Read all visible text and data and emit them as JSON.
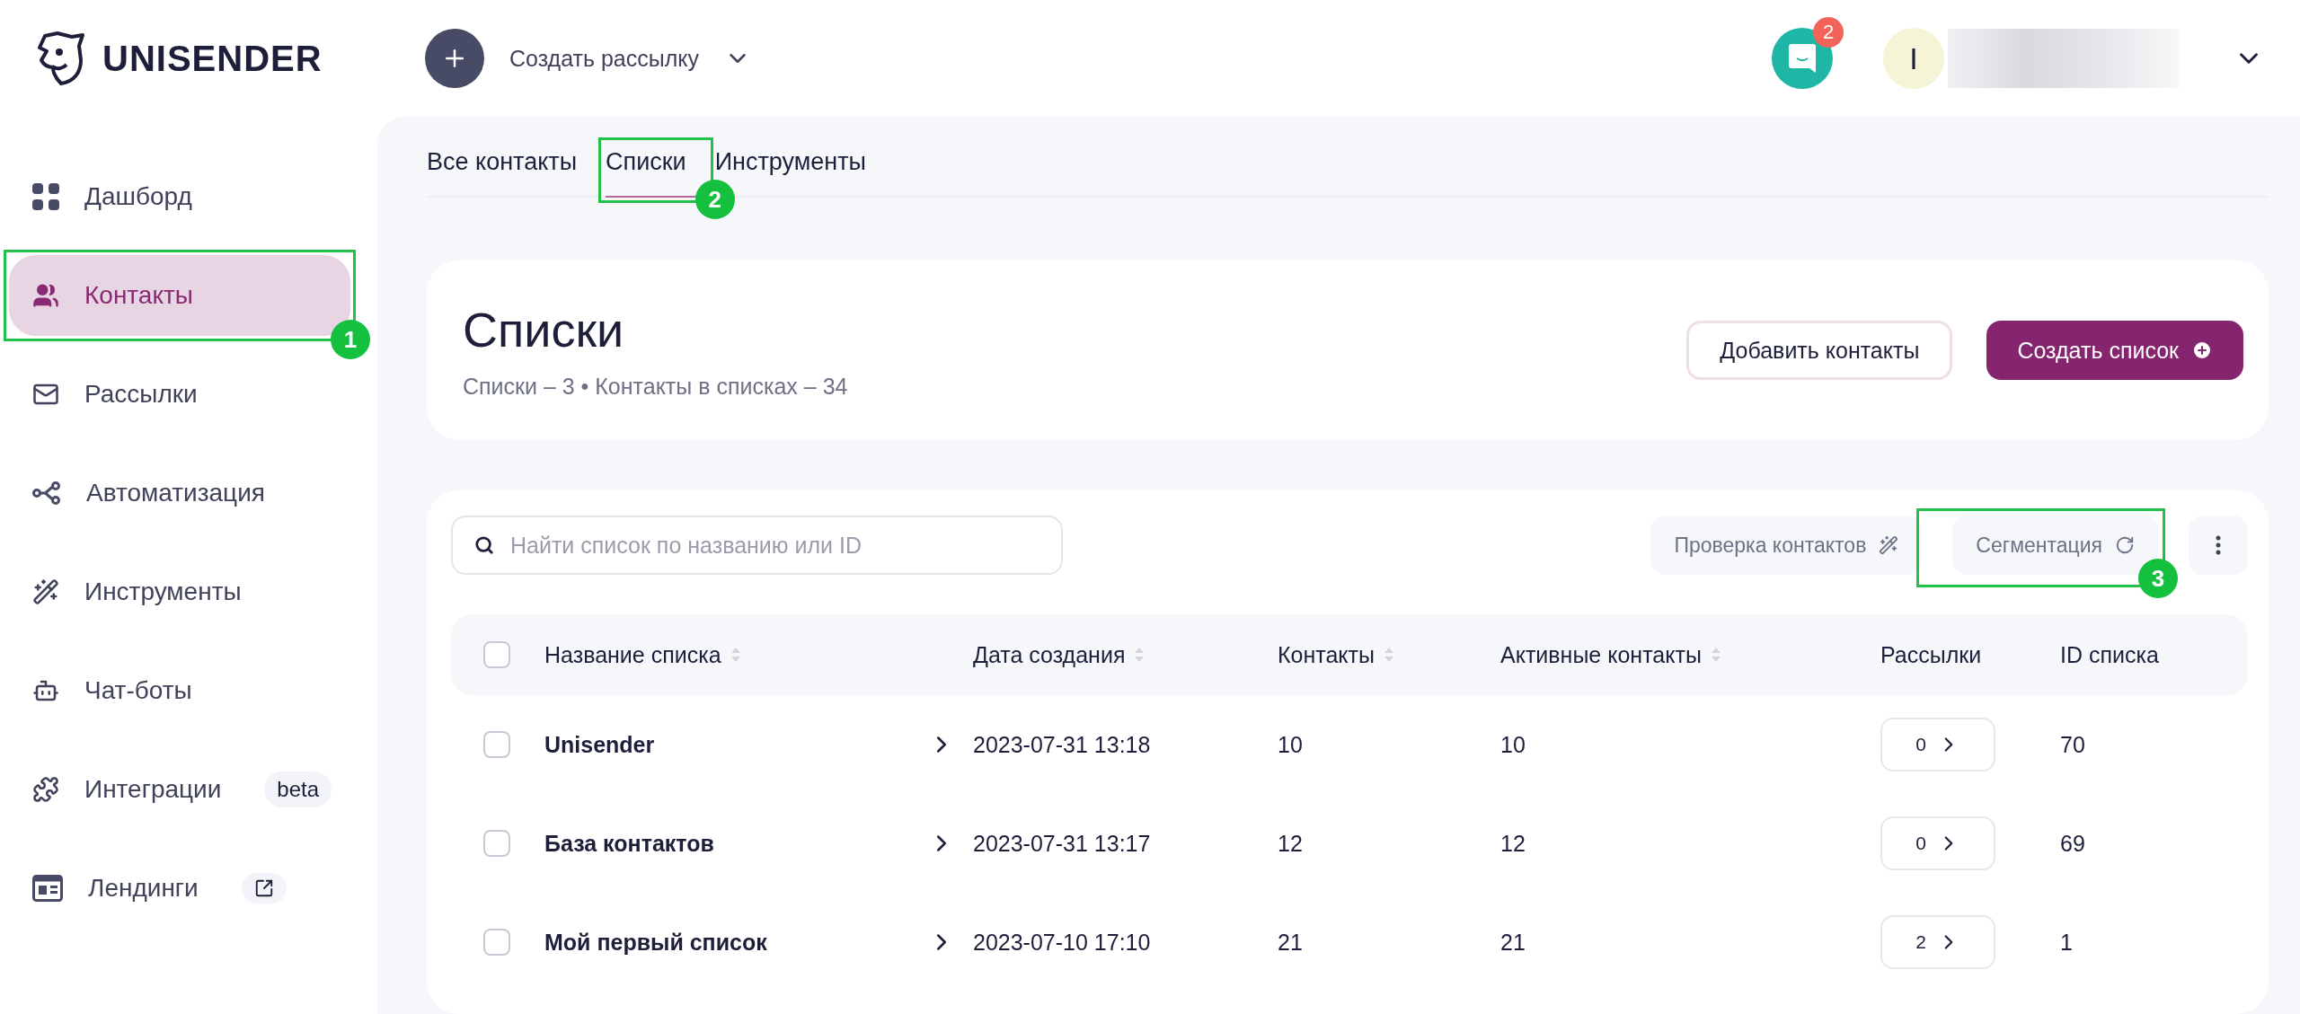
{
  "brand": {
    "name": "UNISENDER"
  },
  "header": {
    "create_label": "Создать рассылку",
    "notifications": {
      "count": "2"
    },
    "avatar": {
      "initial": "I"
    }
  },
  "sidebar": {
    "items": [
      {
        "label": "Дашборд",
        "selected": false
      },
      {
        "label": "Контакты",
        "selected": true,
        "marker": "1"
      },
      {
        "label": "Рассылки",
        "selected": false
      },
      {
        "label": "Автоматизация",
        "selected": false
      },
      {
        "label": "Инструменты",
        "selected": false
      },
      {
        "label": "Чат-боты",
        "selected": false
      },
      {
        "label": "Интеграции",
        "selected": false,
        "badge": "beta"
      },
      {
        "label": "Лендинги",
        "selected": false,
        "external": true
      }
    ]
  },
  "tabs": [
    {
      "label": "Все контакты",
      "selected": false
    },
    {
      "label": "Списки",
      "selected": true,
      "marker": "2"
    },
    {
      "label": "Инструменты",
      "selected": false
    }
  ],
  "page": {
    "title": "Списки",
    "summary": "Списки – 3 • Контакты в списках – 34",
    "buttons": [
      {
        "label": "Добавить контакты",
        "kind": "outline"
      },
      {
        "label": "Создать список",
        "kind": "primary"
      }
    ]
  },
  "toolbar": {
    "search": {
      "placeholder": "Найти список по названию или ID"
    },
    "actions": [
      {
        "label": "Проверка контактов"
      },
      {
        "label": "Сегментация",
        "marker": "3"
      }
    ]
  },
  "table": {
    "header_checked": false,
    "columns": [
      {
        "label": "Название списка",
        "sortable": true
      },
      {
        "label": "Дата создания",
        "sortable": true
      },
      {
        "label": "Контакты",
        "sortable": true
      },
      {
        "label": "Активные контакты",
        "sortable": true
      },
      {
        "label": "Рассылки",
        "sortable": false
      },
      {
        "label": "ID списка",
        "sortable": false
      }
    ],
    "rows": [
      {
        "checked": false,
        "name": "Unisender",
        "date": "2023-07-31 13:18",
        "contacts": "10",
        "active": "10",
        "mailings": "0",
        "id": "70"
      },
      {
        "checked": false,
        "name": "База контактов",
        "date": "2023-07-31 13:17",
        "contacts": "12",
        "active": "12",
        "mailings": "0",
        "id": "69"
      },
      {
        "checked": false,
        "name": "Мой первый список",
        "date": "2023-07-10 17:10",
        "contacts": "21",
        "active": "21",
        "mailings": "2",
        "id": "1"
      }
    ]
  }
}
